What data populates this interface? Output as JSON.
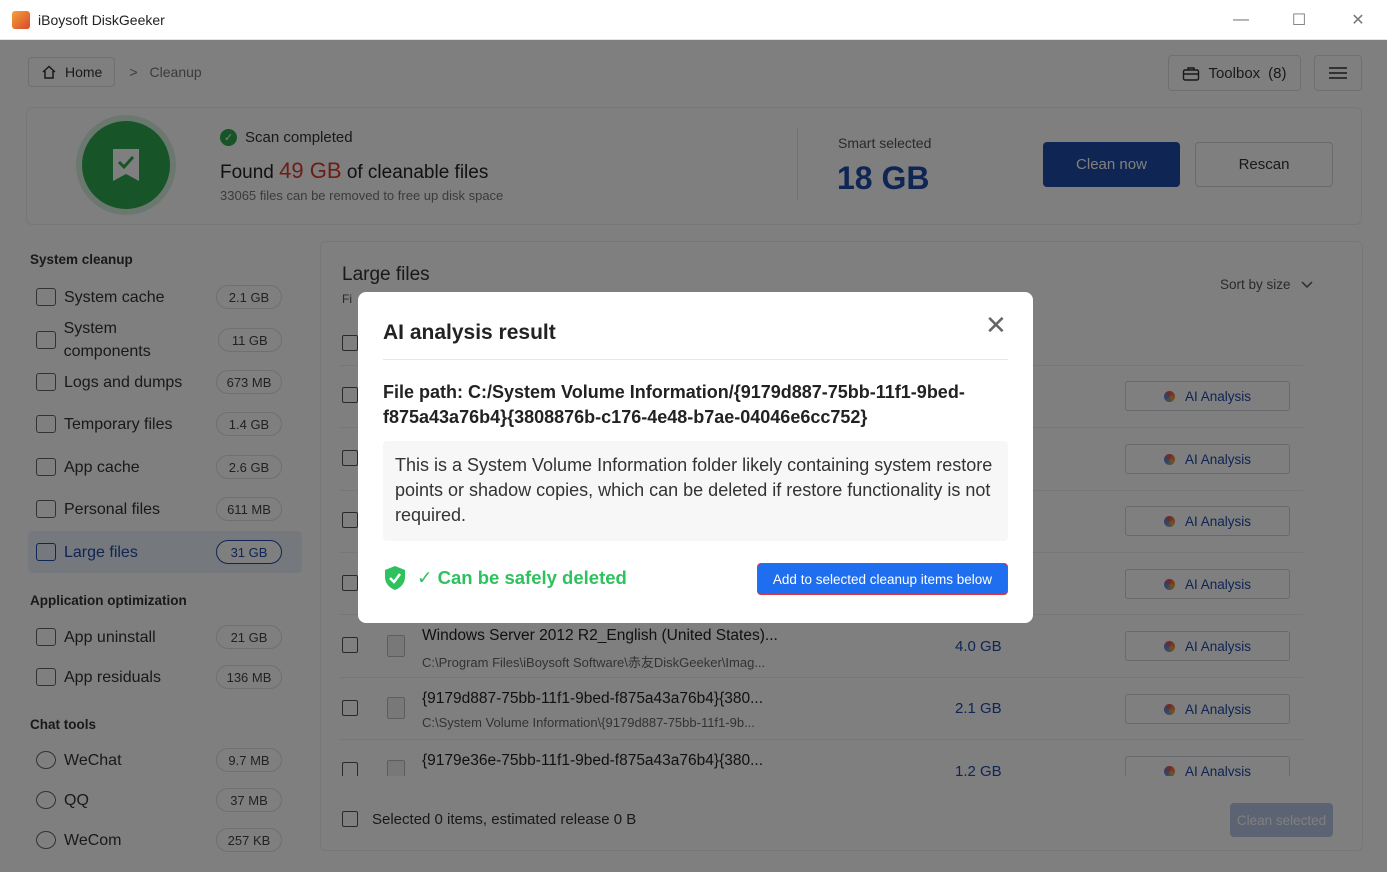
{
  "window": {
    "title": "iBoysoft DiskGeeker",
    "minimize": "—",
    "maximize": "☐",
    "close": "✕"
  },
  "nav": {
    "home": "Home",
    "sep": ">",
    "crumb": "Cleanup",
    "toolbox": "Toolbox",
    "toolbox_count": "(8)"
  },
  "summary": {
    "status": "Scan completed",
    "found_prefix": "Found",
    "found_amount": "49 GB",
    "found_suffix": "of cleanable files",
    "subtitle": "33065 files can be removed to free up disk space",
    "smart_label": "Smart selected",
    "smart_value": "18 GB",
    "clean_now": "Clean now",
    "rescan": "Rescan"
  },
  "sidebar": {
    "system_heading": "System cleanup",
    "system": [
      {
        "label": "System cache",
        "size": "2.1 GB"
      },
      {
        "label": "System components",
        "size": "11 GB"
      },
      {
        "label": "Logs and dumps",
        "size": "673 MB"
      },
      {
        "label": "Temporary files",
        "size": "1.4 GB"
      },
      {
        "label": "App cache",
        "size": "2.6 GB"
      },
      {
        "label": "Personal files",
        "size": "611 MB"
      },
      {
        "label": "Large files",
        "size": "31 GB"
      }
    ],
    "app_heading": "Application optimization",
    "apps": [
      {
        "label": "App uninstall",
        "size": "21 GB"
      },
      {
        "label": "App residuals",
        "size": "136 MB"
      }
    ],
    "chat_heading": "Chat tools",
    "chat": [
      {
        "label": "WeChat",
        "size": "9.7 MB"
      },
      {
        "label": "QQ",
        "size": "37 MB"
      },
      {
        "label": "WeCom",
        "size": "257 KB"
      }
    ]
  },
  "panel": {
    "title": "Large files",
    "subtitle_fragment": "Fi",
    "sort": "Sort by size",
    "ai_label": "AI Analysis",
    "rows": [
      {
        "name": "Windows Server 2012 R2_English (United States)...",
        "path": "C:\\Program Files\\iBoysoft Software\\赤友DiskGeeker\\Imag...",
        "size": "4.0 GB"
      },
      {
        "name": "{9179d887-75bb-11f1-9bed-f875a43a76b4}{380...",
        "path": "C:\\System Volume Information\\{9179d887-75bb-11f1-9b...",
        "size": "2.1 GB"
      },
      {
        "name": "{9179e36e-75bb-11f1-9bed-f875a43a76b4}{380...",
        "path": "",
        "size": "1.2 GB"
      }
    ],
    "footer": "Selected 0 items, estimated release 0 B",
    "clean_selected": "Clean selected"
  },
  "modal": {
    "title": "AI analysis result",
    "close": "✕",
    "path": "File path: C:/System Volume Information/{9179d887-75bb-11f1-9bed-f875a43a76b4}{3808876b-c176-4e48-b7ae-04046e6cc752}",
    "description": "This is a System Volume Information folder likely containing system restore points or shadow copies, which can be deleted if restore functionality is not required.",
    "verdict": "✓ Can be safely deleted",
    "add_button": "Add to selected cleanup items below"
  }
}
